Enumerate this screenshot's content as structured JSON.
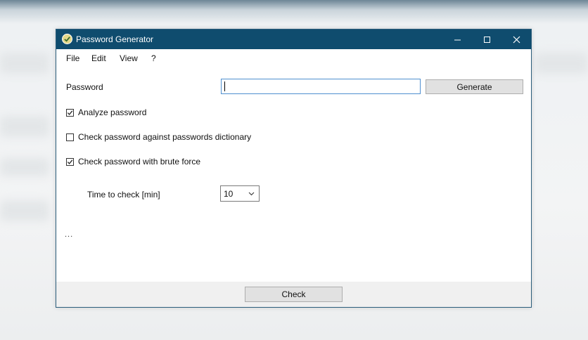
{
  "window": {
    "title": "Password Generator",
    "controls": {
      "minimize": "—",
      "maximize": "☐",
      "close": "✕"
    }
  },
  "menu": {
    "items": [
      "File",
      "Edit",
      "View",
      "?"
    ]
  },
  "form": {
    "password_label": "Password",
    "password_value": "",
    "generate_label": "Generate",
    "analyze": {
      "label": "Analyze password",
      "checked": true
    },
    "dictionary": {
      "label": "Check password against passwords dictionary",
      "checked": false
    },
    "brute_force": {
      "label": "Check password with brute force",
      "checked": true
    },
    "time_label": "Time to check [min]",
    "time_value": "10",
    "status_text": "..."
  },
  "footer": {
    "check_label": "Check"
  },
  "colors": {
    "titlebar": "#0f4c6e",
    "input_focus_border": "#4e8fcf"
  },
  "icons": {
    "app": "password-generator-app-icon",
    "dropdown": "chevron-down-icon"
  }
}
